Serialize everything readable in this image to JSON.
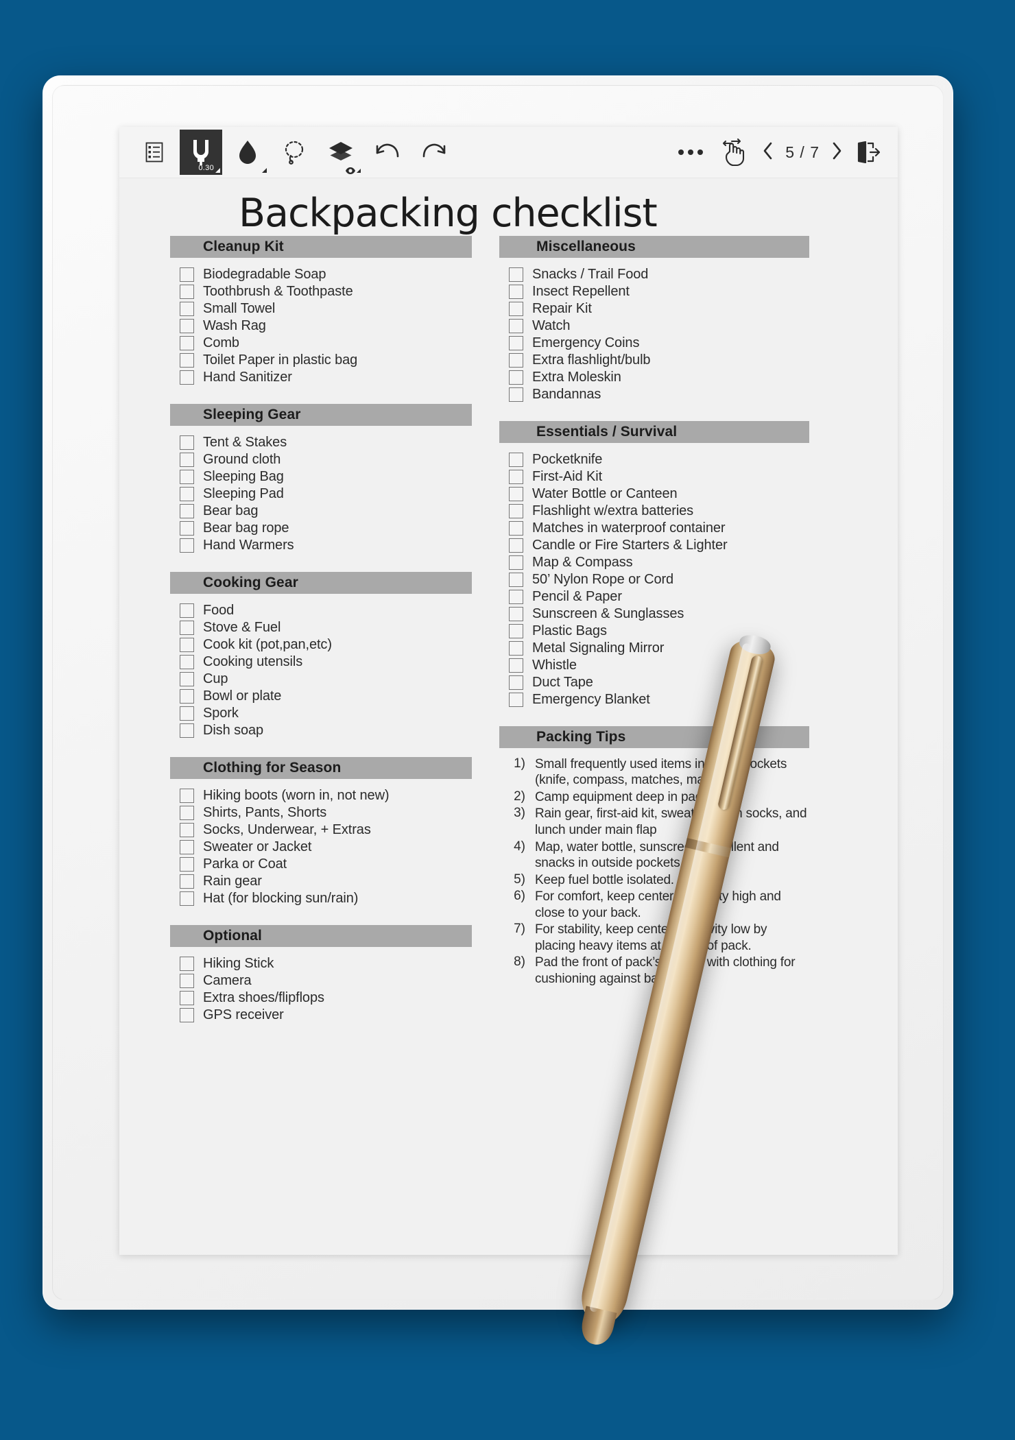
{
  "toolbar": {
    "tools": [
      {
        "name": "notes-list-icon",
        "label": "Notes list"
      },
      {
        "name": "pen-tool-icon",
        "label": "Pen",
        "size": "0.30",
        "active": true
      },
      {
        "name": "eraser-tool-icon",
        "label": "Eraser"
      },
      {
        "name": "lasso-select-icon",
        "label": "Lasso select"
      },
      {
        "name": "layers-icon",
        "label": "Layers"
      },
      {
        "name": "undo-icon",
        "label": "Undo"
      },
      {
        "name": "redo-icon",
        "label": "Redo"
      }
    ],
    "more_label": "More options",
    "gesture_label": "Pan gesture",
    "prev_label": "Previous page",
    "next_label": "Next page",
    "page_indicator": "5 / 7",
    "exit_label": "Exit"
  },
  "document": {
    "title": "Backpacking checklist",
    "left_sections": [
      {
        "heading": "Cleanup Kit",
        "items": [
          "Biodegradable Soap",
          "Toothbrush & Toothpaste",
          "Small Towel",
          "Wash Rag",
          "Comb",
          "Toilet Paper in plastic bag",
          "Hand Sanitizer"
        ]
      },
      {
        "heading": "Sleeping Gear",
        "items": [
          "Tent & Stakes",
          "Ground cloth",
          "Sleeping Bag",
          "Sleeping Pad",
          "Bear bag",
          "Bear bag rope",
          "Hand Warmers"
        ]
      },
      {
        "heading": "Cooking Gear",
        "items": [
          "Food",
          "Stove & Fuel",
          "Cook kit (pot,pan,etc)",
          "Cooking utensils",
          "Cup",
          "Bowl or plate",
          "Spork",
          "Dish soap"
        ]
      },
      {
        "heading": "Clothing for Season",
        "items": [
          "Hiking boots (worn in, not new)",
          "Shirts, Pants, Shorts",
          "Socks, Underwear, + Extras",
          "Sweater or Jacket",
          "Parka or Coat",
          "Rain gear",
          "Hat (for blocking sun/rain)"
        ]
      },
      {
        "heading": "Optional",
        "items": [
          "Hiking Stick",
          "Camera",
          "Extra shoes/flipflops",
          "GPS receiver"
        ]
      }
    ],
    "right_sections": [
      {
        "heading": "Miscellaneous",
        "items": [
          "Snacks / Trail Food",
          "Insect Repellent",
          "Repair Kit",
          "Watch",
          "Emergency Coins",
          "Extra flashlight/bulb",
          "Extra Moleskin",
          "Bandannas"
        ]
      },
      {
        "heading": "Essentials / Survival",
        "items": [
          "Pocketknife",
          "First-Aid Kit",
          "Water Bottle or Canteen",
          "Flashlight w/extra batteries",
          "Matches in waterproof container",
          "Candle or Fire Starters & Lighter",
          "Map & Compass",
          "50’ Nylon Rope or Cord",
          "Pencil & Paper",
          "Sunscreen & Sunglasses",
          "Plastic Bags",
          "Metal Signaling Mirror",
          "Whistle",
          "Duct Tape",
          "Emergency Blanket"
        ]
      }
    ],
    "tips_section": {
      "heading": "Packing Tips",
      "tips": [
        {
          "num": "1)",
          "text": "Small frequently used items in pants pockets (knife, compass, matches, map)"
        },
        {
          "num": "2)",
          "text": "Camp equipment deep in pack"
        },
        {
          "num": "3)",
          "text": "Rain gear, first-aid kit, sweater, clean socks, and lunch under main flap"
        },
        {
          "num": "4)",
          "text": "Map, water bottle, sunscreen, repellent and snacks in outside pockets."
        },
        {
          "num": "5)",
          "text": "Keep fuel bottle isolated."
        },
        {
          "num": "6)",
          "text": "For comfort, keep center of gravity high and close to your back."
        },
        {
          "num": "7)",
          "text": "For stability, keep center of gravity low by placing heavy items at bottom of pack."
        },
        {
          "num": "8)",
          "text": "Pad the front of pack’s interior with clothing for cushioning against back."
        }
      ]
    }
  },
  "colors": {
    "background": "#07588a",
    "section_header": "#a9a9a9",
    "page": "#f1f1f1",
    "active_tool": "#333333"
  }
}
